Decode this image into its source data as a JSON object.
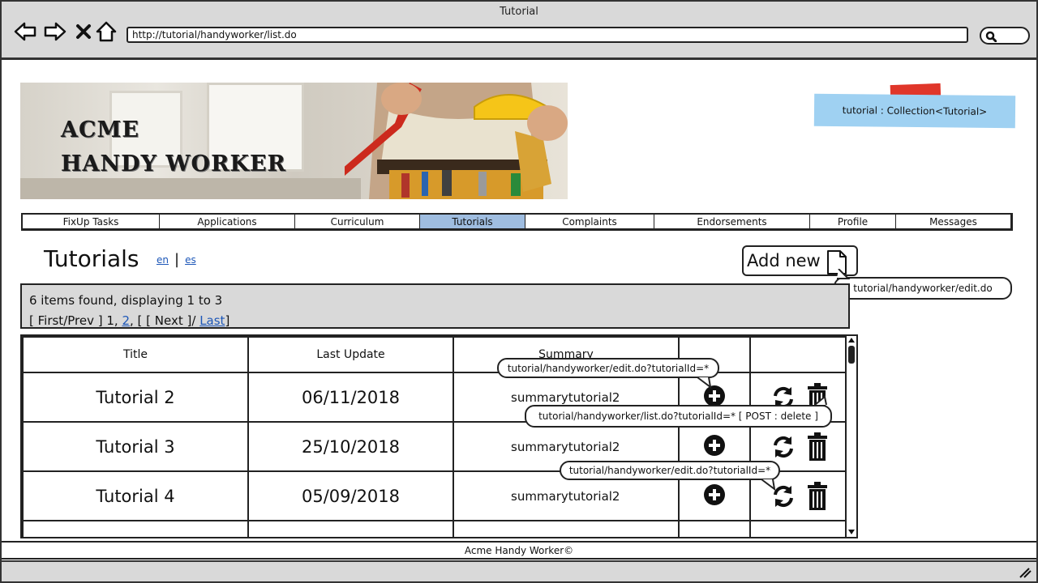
{
  "window": {
    "title": "Tutorial",
    "url": "http://tutorial/handyworker/list.do"
  },
  "banner": {
    "line1": "ACME",
    "line2": "HANDY WORKER"
  },
  "note": {
    "text": "tutorial : Collection<Tutorial>"
  },
  "nav": {
    "tabs": [
      "FixUp Tasks",
      "Applications",
      "Curriculum",
      "Tutorials",
      "Complaints",
      "Endorsements",
      "Profile",
      "Messages"
    ],
    "active": "Tutorials"
  },
  "page": {
    "title": "Tutorials",
    "lang_en": "en",
    "lang_sep": "|",
    "lang_es": "es",
    "add_new": "Add new"
  },
  "callouts": {
    "add_new_target": "tutorial/handyworker/edit.do",
    "display_target": "tutorial/handyworker/edit.do?tutorialId=*",
    "delete_target": "tutorial/handyworker/list.do?tutorialId=*  [ POST : delete ]",
    "edit_target": "tutorial/handyworker/edit.do?tutorialId=*"
  },
  "pager": {
    "summary": "6 items found, displaying 1 to 3",
    "open": "[ First/Prev ] 1,",
    "page2": "2",
    "middle": ", [ [ Next ]/",
    "last": "Last",
    "close": "]"
  },
  "table": {
    "headers": [
      "Title",
      "Last Update",
      "Summary",
      "",
      ""
    ],
    "rows": [
      {
        "title": "Tutorial 2",
        "date": "06/11/2018",
        "summary": "summarytutorial2"
      },
      {
        "title": "Tutorial 3",
        "date": "25/10/2018",
        "summary": "summarytutorial2"
      },
      {
        "title": "Tutorial 4",
        "date": "05/09/2018",
        "summary": "summarytutorial2"
      }
    ]
  },
  "footer": {
    "text": "Acme Handy Worker©"
  },
  "colors": {
    "active_tab": "#9fbde0",
    "note": "#9fd1f2",
    "note_tape": "#e0362a",
    "chrome": "#d9d9d9",
    "link": "#1d57b8"
  },
  "icons": [
    "back-arrow-icon",
    "forward-arrow-icon",
    "close-icon",
    "home-icon",
    "search-icon",
    "document-icon",
    "plus-circle-icon",
    "refresh-icon",
    "trash-icon",
    "resize-grip-icon"
  ]
}
